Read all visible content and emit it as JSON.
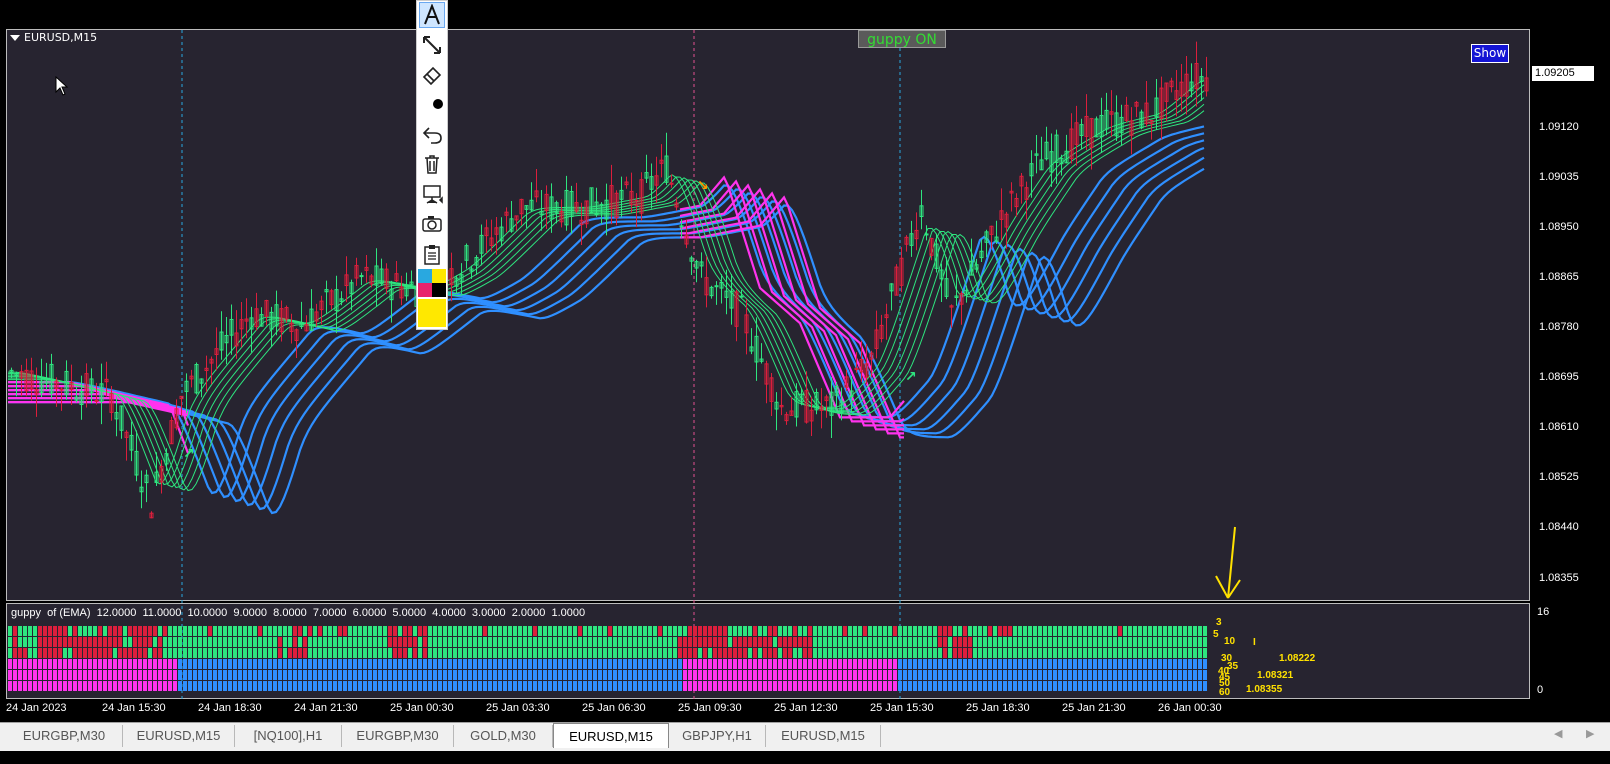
{
  "chart": {
    "symbol": "EURUSD,M15",
    "guppy_button": "guppy ON",
    "show_button": "Show",
    "current_price": "1.09205",
    "price_labels": [
      "1.09120",
      "1.09035",
      "1.08950",
      "1.08865",
      "1.08780",
      "1.08695",
      "1.08610",
      "1.08525",
      "1.08440",
      "1.08355"
    ],
    "time_labels": [
      "24 Jan 2023",
      "24 Jan 15:30",
      "24 Jan 18:30",
      "24 Jan 21:30",
      "25 Jan 00:30",
      "25 Jan 03:30",
      "25 Jan 06:30",
      "25 Jan 09:30",
      "25 Jan 12:30",
      "25 Jan 15:30",
      "25 Jan 18:30",
      "25 Jan 21:30",
      "26 Jan 00:30"
    ],
    "colors": {
      "background": "#272430",
      "bull": "#2ee57f",
      "bear": "#dc1e3c",
      "fast_ema": "#2ee57f",
      "slow_ema_up": "#2f8fff",
      "slow_ema_down": "#ff33ee"
    }
  },
  "indicator": {
    "title": "guppy  of (EMA)  12.0000  11.0000  10.0000  9.0000  8.0000  7.0000  6.0000  5.0000  4.0000  3.0000  2.0000  1.0000",
    "scale_max": "16",
    "scale_min": "0",
    "annotations": {
      "p3": "3",
      "p5": "5",
      "p10": "10",
      "p30": "30",
      "p35": "35",
      "p40": "40",
      "p45": "45",
      "p50": "50",
      "p60": "60",
      "v1": "1.08222",
      "v2": "1.08321",
      "v3": "1.08355",
      "mark": "I"
    }
  },
  "toolbar": {
    "items": [
      "text-tool",
      "arrow-tool",
      "eraser-tool",
      "dot-tool",
      "undo-tool",
      "delete-tool",
      "presentation-tool",
      "screenshot-tool",
      "clipboard-tool"
    ],
    "swatches": [
      "#29a8e0",
      "#ffe800",
      "#e8236d",
      "#000000",
      "#ffe800"
    ]
  },
  "tabs": [
    "EURGBP,M30",
    "EURUSD,M15",
    "[NQ100],H1",
    "EURGBP,M30",
    "GOLD,M30",
    "EURUSD,M15",
    "GBPJPY,H1",
    "EURUSD,M15"
  ],
  "active_tab": 5
}
